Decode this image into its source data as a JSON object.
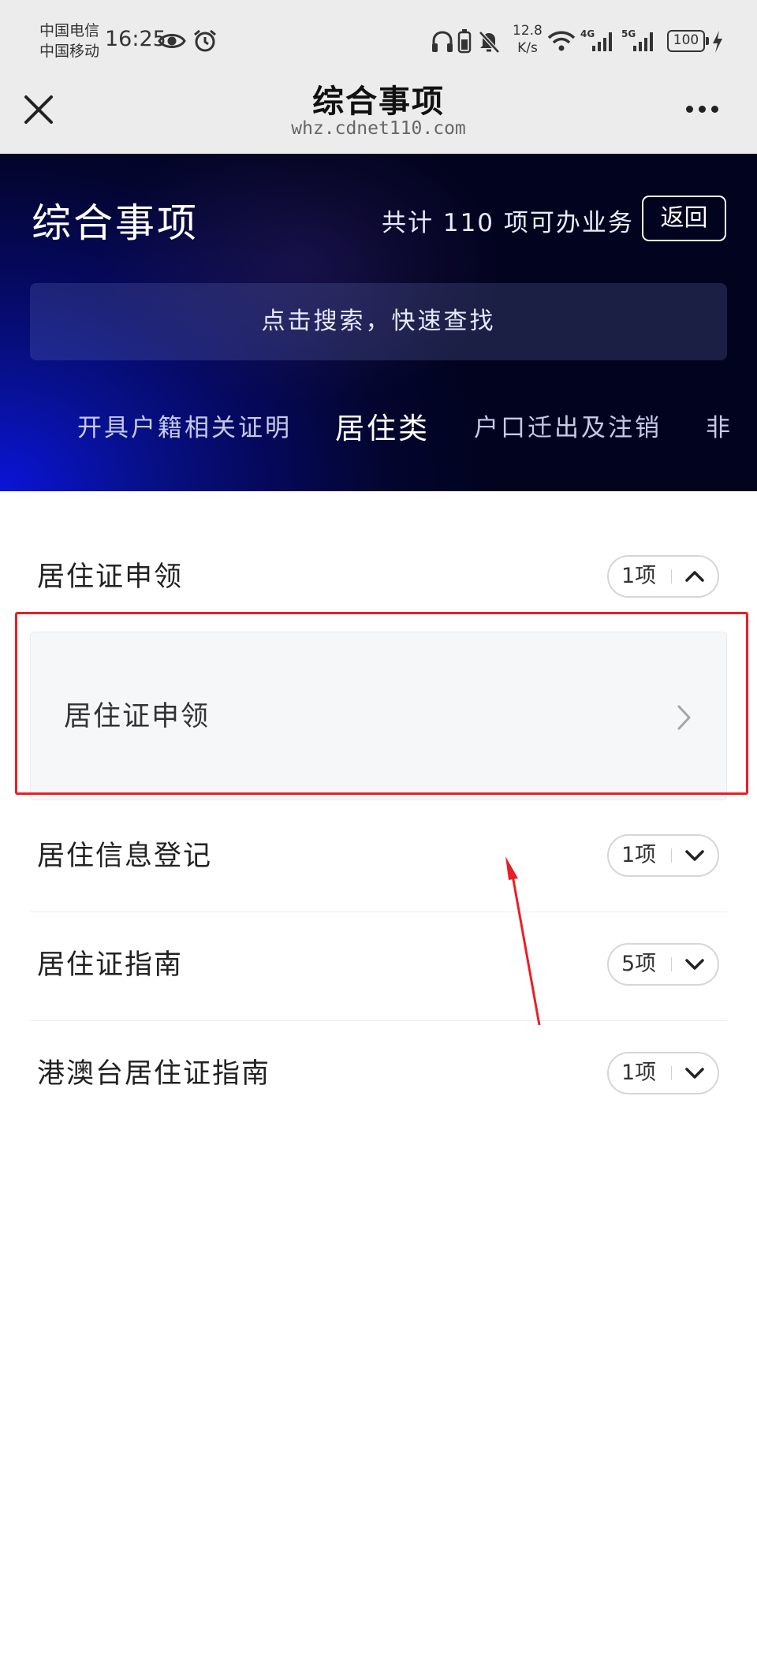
{
  "status_bar": {
    "carrier_1": "中国电信",
    "carrier_2": "中国移动",
    "time": "16:25",
    "net_speed_value": "12.8",
    "net_speed_unit": "K/s",
    "signal_1_label": "4G",
    "signal_2_label": "5G",
    "battery": "100",
    "icons": [
      "eye-icon",
      "alarm-icon",
      "headphones-icon",
      "battery-saver-icon",
      "mute-icon",
      "wifi-icon",
      "signal-icon",
      "charging-icon"
    ]
  },
  "title_bar": {
    "title": "综合事项",
    "url": "whz.cdnet110.com"
  },
  "hero": {
    "title": "综合事项",
    "count_text": "共计 110 项可办业务",
    "back_label": "返回",
    "search_placeholder": "点击搜索，快速查找",
    "tabs": [
      {
        "label": "开具户籍相关证明",
        "active": false
      },
      {
        "label": "居住类",
        "active": true
      },
      {
        "label": "户口迁出及注销",
        "active": false
      },
      {
        "label": "非",
        "active": false
      }
    ]
  },
  "groups": [
    {
      "title": "居住证申领",
      "count": "1项",
      "expanded": true,
      "items": [
        {
          "label": "居住证申领"
        }
      ]
    },
    {
      "title": "居住信息登记",
      "count": "1项",
      "expanded": false
    },
    {
      "title": "居住证指南",
      "count": "5项",
      "expanded": false
    },
    {
      "title": "港澳台居住证指南",
      "count": "1项",
      "expanded": false
    }
  ],
  "colors": {
    "hero_dark": "#03052e",
    "hero_blue": "#0a14d8",
    "annotation_red": "#ea1f24"
  }
}
